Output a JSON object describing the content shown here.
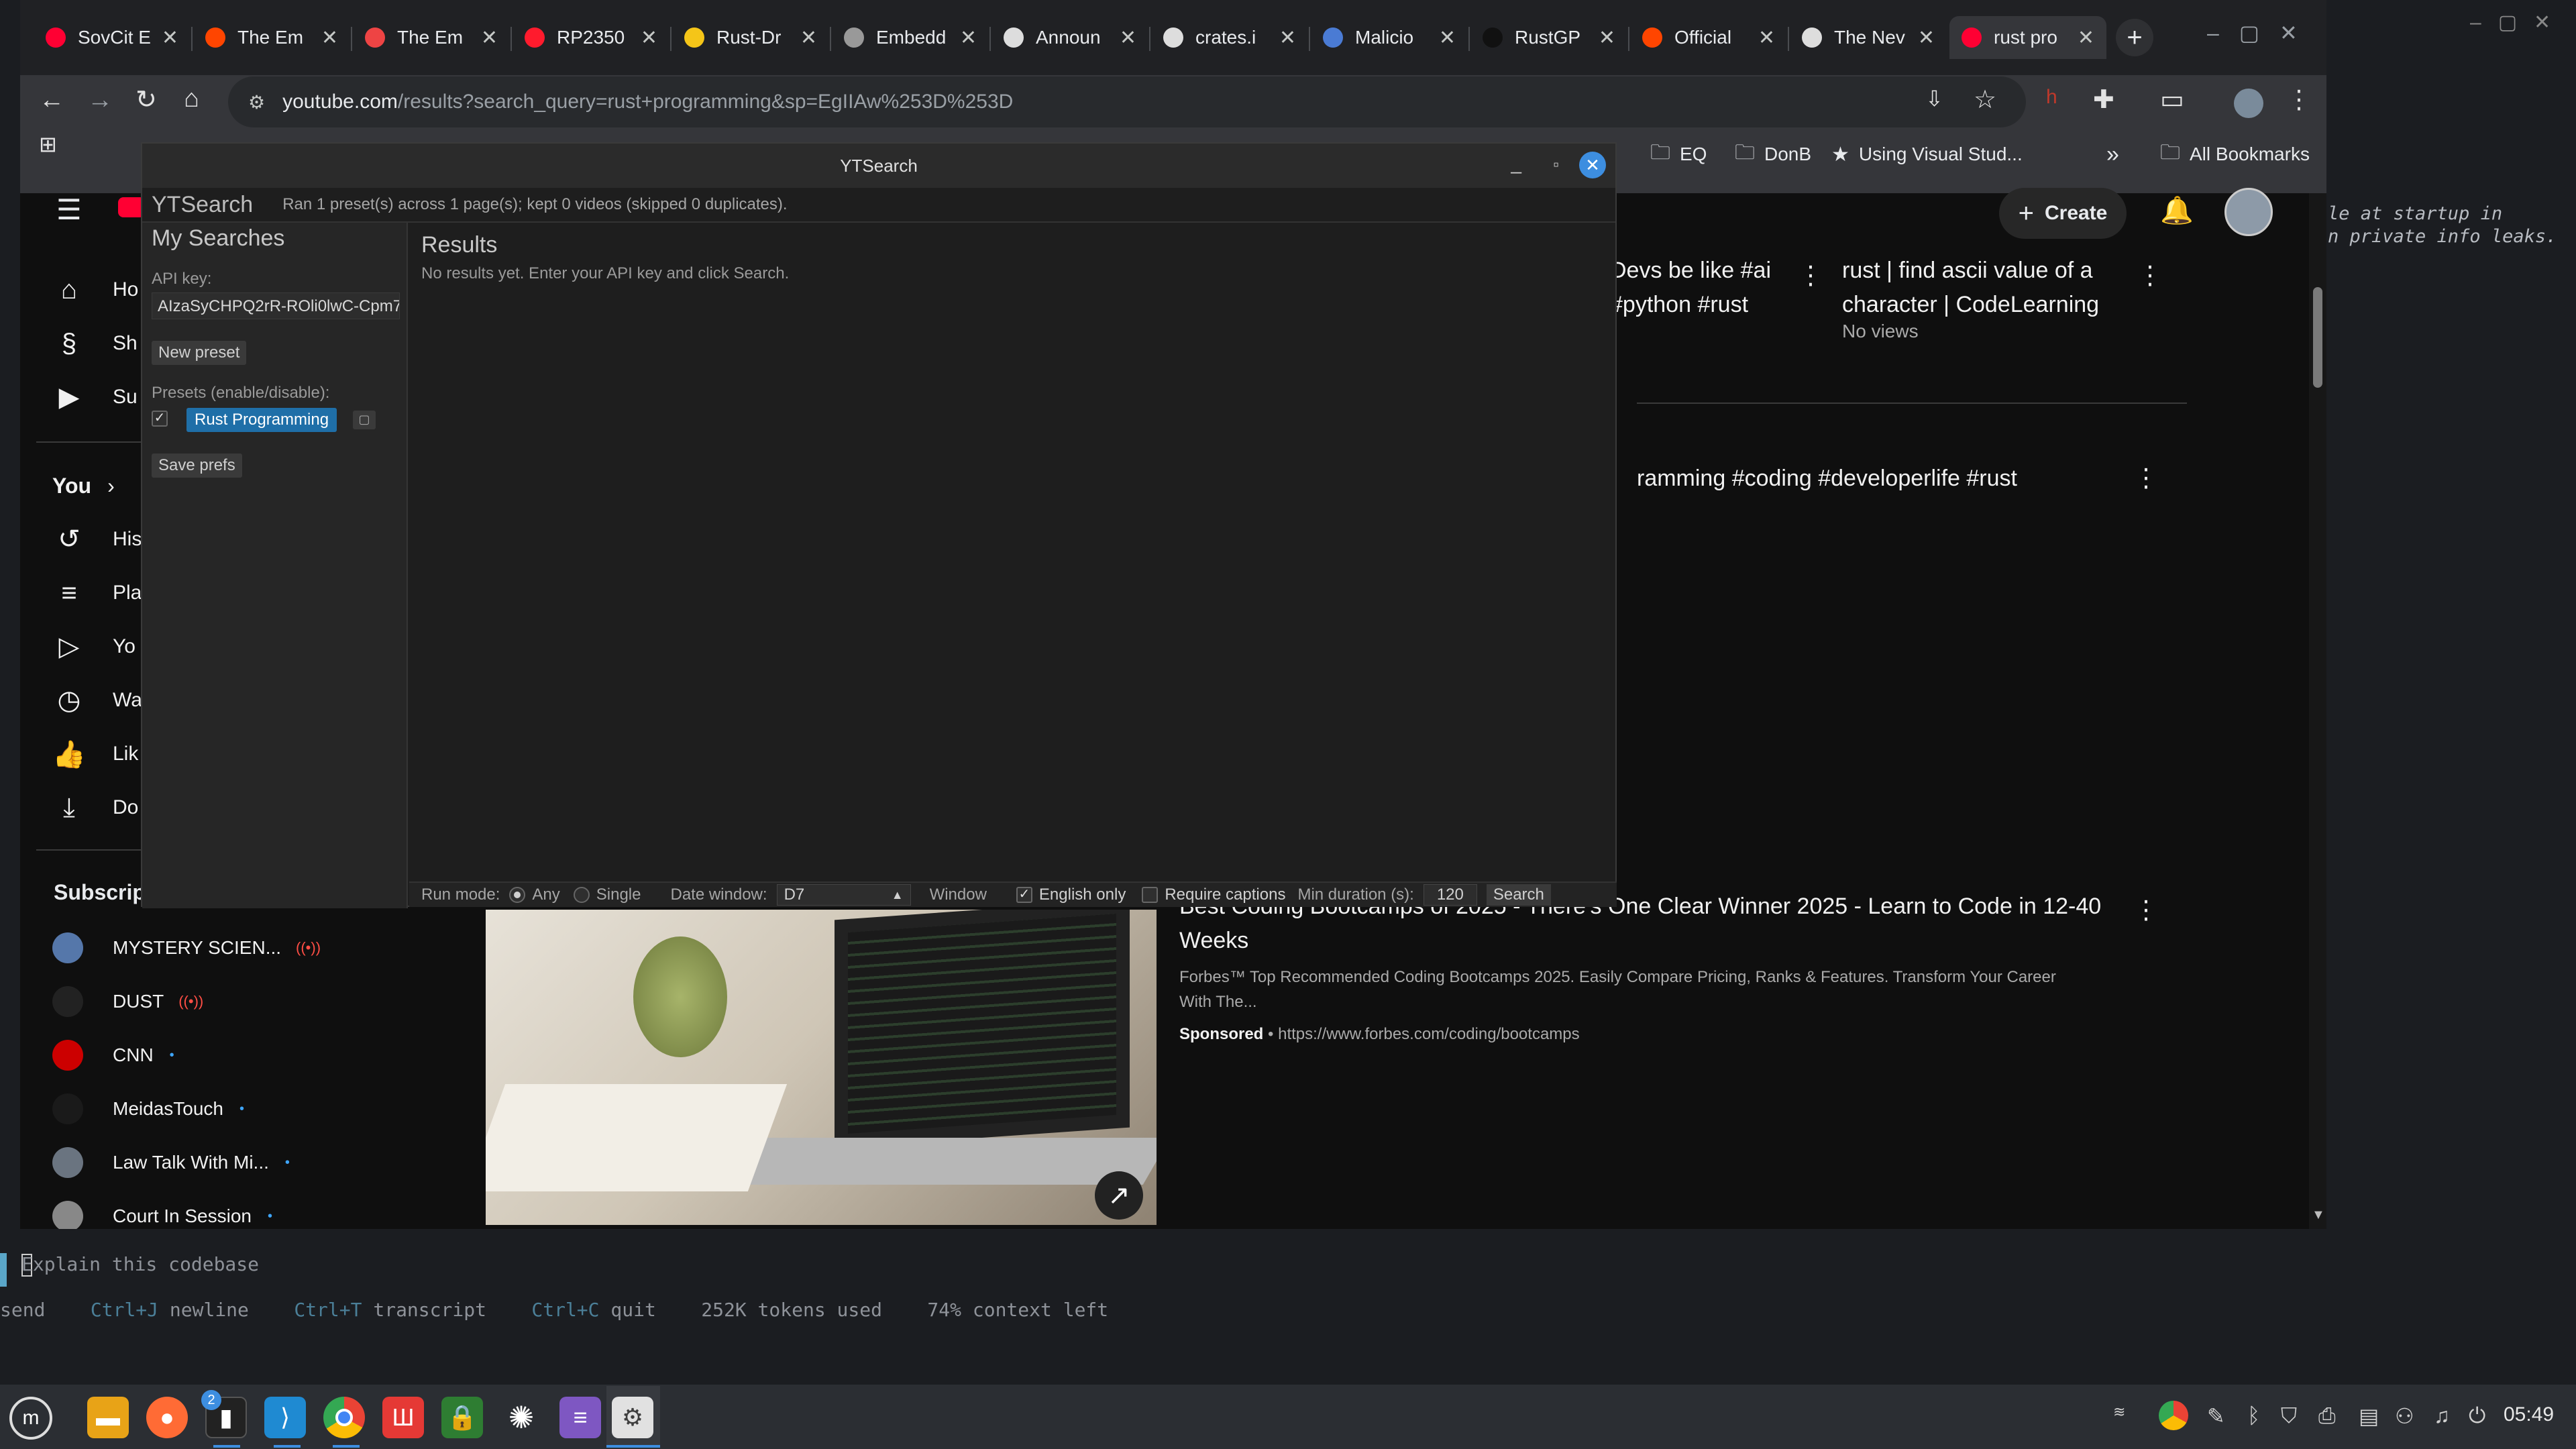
{
  "browser": {
    "tabs": [
      {
        "title": "SovCit E",
        "color": "#ff0033"
      },
      {
        "title": "The Em",
        "color": "#ff4500"
      },
      {
        "title": "The Em",
        "color": "#e44"
      },
      {
        "title": "RP2350",
        "color": "#ff1b2d"
      },
      {
        "title": "Rust-Dr",
        "color": "#f5c518"
      },
      {
        "title": "Embedd",
        "color": "#999"
      },
      {
        "title": "Announ",
        "color": "#ddd"
      },
      {
        "title": "crates.i",
        "color": "#ddd"
      },
      {
        "title": "Malicio",
        "color": "#4a7bd4"
      },
      {
        "title": "RustGP",
        "color": "#111"
      },
      {
        "title": "Official",
        "color": "#ff4500"
      },
      {
        "title": "The Nev",
        "color": "#ddd"
      },
      {
        "title": "rust pro",
        "color": "#ff0033"
      }
    ],
    "new_tab": "+",
    "url_host": "youtube.com",
    "url_path": "/results?search_query=rust+programming&sp=EgIIAw%253D%253D",
    "bookmarks": [
      {
        "icon": "folder-icon",
        "label": "EQ"
      },
      {
        "icon": "folder-icon",
        "label": "DonB"
      },
      {
        "icon": "star-icon",
        "label": "Using Visual Stud..."
      }
    ],
    "bookmarks_more": "»",
    "all_bookmarks": "All Bookmarks",
    "accent": "#8ab4f8"
  },
  "youtube": {
    "create_label": "Create",
    "sidebar": [
      {
        "label": "Ho",
        "icon": "home-icon"
      },
      {
        "label": "Sh",
        "icon": "shorts-icon"
      },
      {
        "label": "Su",
        "icon": "subscriptions-icon"
      }
    ],
    "you_label": "You",
    "you_items": [
      {
        "label": "His",
        "icon": "history-icon"
      },
      {
        "label": "Pla",
        "icon": "playlists-icon"
      },
      {
        "label": "Yo",
        "icon": "your-videos-icon"
      },
      {
        "label": "Wa",
        "icon": "watch-later-icon"
      },
      {
        "label": "Lik",
        "icon": "liked-icon"
      },
      {
        "label": "Do",
        "icon": "downloads-icon"
      }
    ],
    "subscriptions_label": "Subscrip",
    "subscriptions": [
      {
        "name": "MYSTERY SCIEN...",
        "badge": "live",
        "color": "#5577aa"
      },
      {
        "name": "DUST",
        "badge": "live",
        "color": "#222"
      },
      {
        "name": "CNN",
        "badge": "dot",
        "color": "#cc0000"
      },
      {
        "name": "MeidasTouch",
        "badge": "dot",
        "color": "#1a1a1a"
      },
      {
        "name": "Law Talk With Mi...",
        "badge": "dot",
        "color": "#6a7480"
      },
      {
        "name": "Court In Session",
        "badge": "dot",
        "color": "#888"
      }
    ],
    "live_glyph": "((•))",
    "dot_glyph": "•",
    "results": {
      "r1_title": "Devs be like #ai #python #rust",
      "r2_title": "rust | find ascii value of a character | CodeLearning",
      "r2_meta": "No views",
      "r3_title": "ramming #coding #developerlife #rust",
      "ad_title": "Best Coding Bootcamps of 2025 - There's One Clear Winner 2025 - Learn to Code in 12-40 Weeks",
      "ad_desc": "Forbes™ Top Recommended Coding Bootcamps 2025. Easily Compare Pricing, Ranks & Features. Transform Your Career With The...",
      "ad_sponsored": "Sponsored",
      "ad_sep": "•",
      "ad_url": "https://www.forbes.com/coding/bootcamps"
    }
  },
  "ytsearch": {
    "window_title": "YTSearch",
    "app_name": "YTSearch",
    "status": "Ran 1 preset(s) across 1 page(s); kept 0 videos (skipped 0 duplicates).",
    "my_searches": "My Searches",
    "api_key_label": "API key:",
    "api_key_value": "AIzaSyCHPQ2rR-ROli0lwC-Cpm7",
    "new_preset": "New preset",
    "presets_label": "Presets (enable/disable):",
    "preset_name": "Rust Programming",
    "save_prefs": "Save prefs",
    "results_heading": "Results",
    "results_empty": "No results yet. Enter your API key and click Search.",
    "run_mode_label": "Run mode:",
    "run_any": "Any",
    "run_single": "Single",
    "date_window_label": "Date window:",
    "date_window_value": "D7",
    "window_label": "Window",
    "english_only": "English only",
    "require_captions": "Require captions",
    "min_duration_label": "Min duration (s):",
    "min_duration_value": "120",
    "search_button": "Search",
    "check_glyph": "✓",
    "accent": "#1f6fa8"
  },
  "terminal": {
    "right_text_1": "le at startup in",
    "right_text_2": "n private info leaks.",
    "prompt_placeholder": "Explain this codebase",
    "hint_send": "send",
    "hint_newline_key": "Ctrl+J",
    "hint_newline": "newline",
    "hint_transcript_key": "Ctrl+T",
    "hint_transcript": "transcript",
    "hint_quit_key": "Ctrl+C",
    "hint_quit": "quit",
    "tokens_used": "252K tokens used",
    "context_left": "74% context left"
  },
  "taskbar": {
    "notification_count": "2",
    "clock": "05:49"
  }
}
